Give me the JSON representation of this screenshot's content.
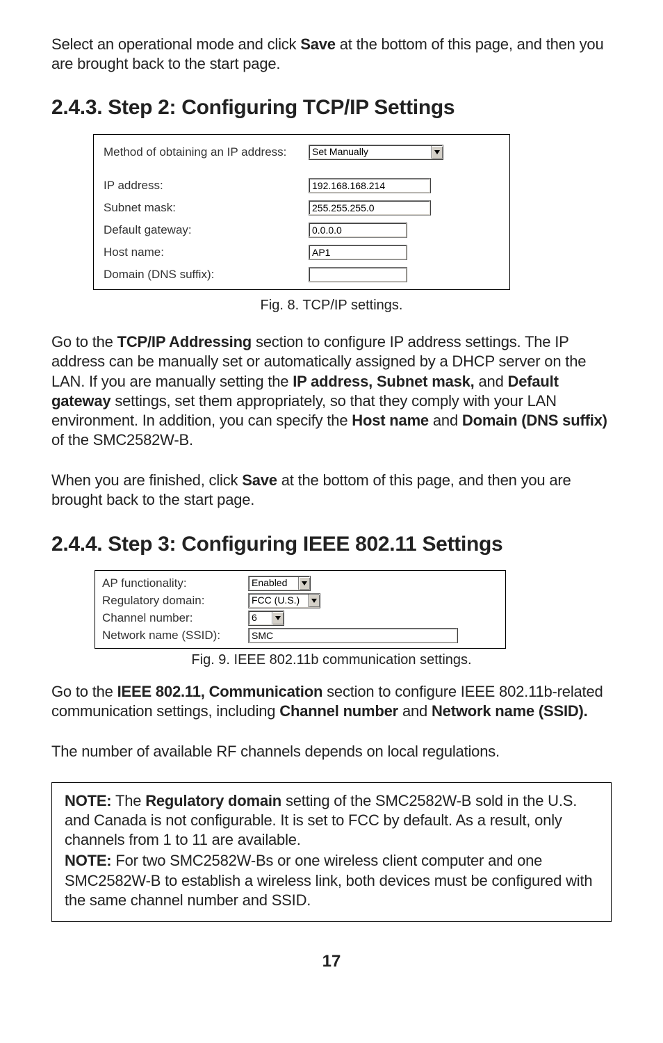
{
  "intro_para": {
    "prefix": "Select an operational mode and click ",
    "save": "Save",
    "suffix": " at the bottom of this page, and then you are brought back to the start page."
  },
  "h243": "2.4.3. Step 2: Configuring TCP/IP Settings",
  "fig8": {
    "caption": "Fig. 8. TCP/IP settings.",
    "rows": {
      "method_label": "Method of obtaining an IP address:",
      "method_value": "Set Manually",
      "ip_label": "IP address:",
      "ip_value": "192.168.168.214",
      "subnet_label": "Subnet mask:",
      "subnet_value": "255.255.255.0",
      "gateway_label": "Default gateway:",
      "gateway_value": "0.0.0.0",
      "host_label": "Host name:",
      "host_value": "AP1",
      "dns_label": "Domain (DNS suffix):",
      "dns_value": ""
    }
  },
  "para_tcpip": {
    "p1": "Go to the ",
    "b1": "TCP/IP Addressing",
    "p2": " section to configure IP address settings. The IP address can be manually set or automatically assigned by a DHCP server on the LAN. If you are manually setting the ",
    "b2": "IP address, Subnet mask,",
    "p3": " and ",
    "b3": "Default gateway",
    "p4": " settings, set them appropriately, so that they comply with your LAN environment. In addition, you can specify the ",
    "b4": "Host name",
    "p5": " and ",
    "b5": "Domain (DNS suffix)",
    "p6": " of the SMC2582W-B."
  },
  "para_save2": {
    "p1": "When you are finished, click ",
    "b1": "Save",
    "p2": " at the bottom of this page, and then you are brought back to the start page."
  },
  "h244": "2.4.4. Step 3: Configuring IEEE 802.11 Settings",
  "fig9": {
    "caption": "Fig. 9. IEEE 802.11b communication settings.",
    "rows": {
      "ap_label": "AP functionality:",
      "ap_value": "Enabled",
      "reg_label": "Regulatory domain:",
      "reg_value": "FCC (U.S.)",
      "chan_label": "Channel number:",
      "chan_value": "6",
      "ssid_label": "Network name (SSID):",
      "ssid_value": "SMC"
    }
  },
  "para_ieee": {
    "p1": "Go to the ",
    "b1": "IEEE 802.11, Communication",
    "p2": " section to configure IEEE 802.11b-related communication settings, including ",
    "b2": "Channel number",
    "p3": " and ",
    "b3": "Network name (SSID)."
  },
  "para_rf": "The number of available RF channels depends on local regulations.",
  "note": {
    "n1a": "NOTE:",
    "n1b": " The ",
    "n1c": "Regulatory domain",
    "n1d": " setting of the SMC2582W-B sold in the U.S. and Canada is not configurable. It is set to FCC by default. As a result, only channels from 1 to 11 are available.",
    "n2a": "NOTE:",
    "n2b": " For two SMC2582W-Bs or one wireless client computer and one SMC2582W-B to establish a wireless link, both devices must be configured with the same channel number and SSID."
  },
  "page_number": "17"
}
